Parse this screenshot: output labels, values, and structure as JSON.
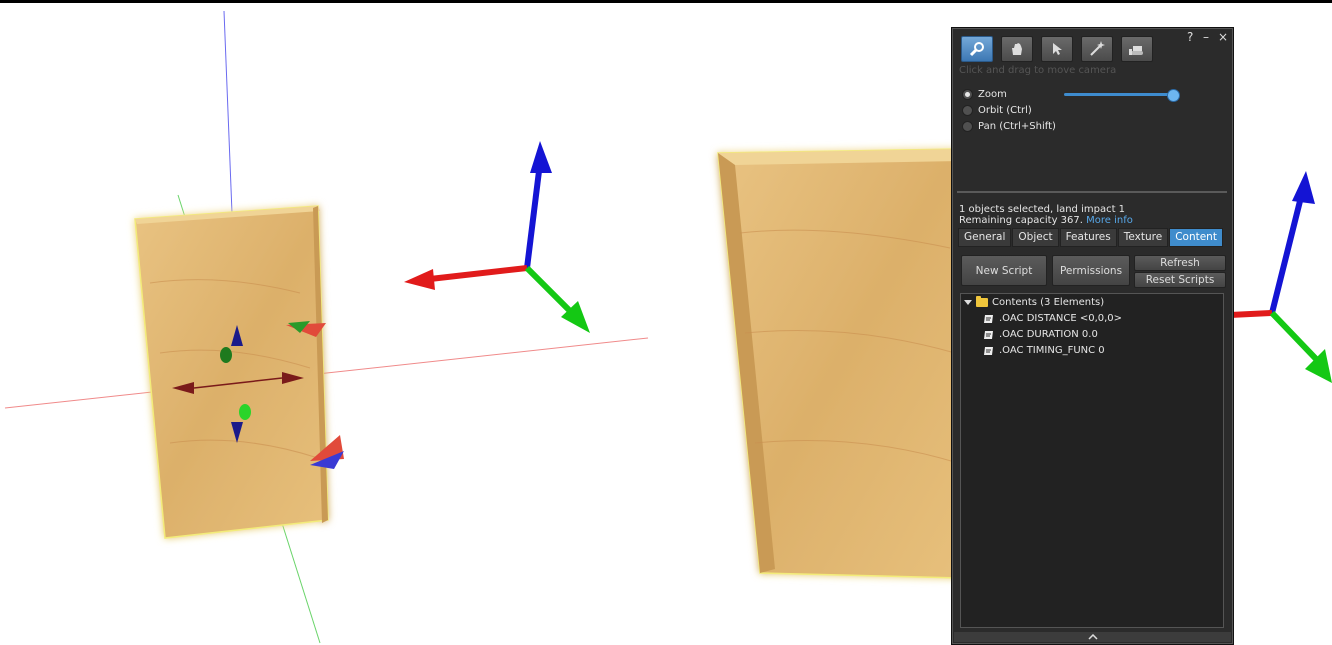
{
  "toolbar": {
    "tools": [
      {
        "name": "focus-tool",
        "icon": "magnifier-icon",
        "active": true
      },
      {
        "name": "move-tool",
        "icon": "hand-icon",
        "active": false
      },
      {
        "name": "edit-tool",
        "icon": "cursor-arrow-icon",
        "active": false
      },
      {
        "name": "create-tool",
        "icon": "wand-icon",
        "active": false
      },
      {
        "name": "land-tool",
        "icon": "bulldozer-icon",
        "active": false
      }
    ],
    "help_label": "?",
    "minimize_label": "–",
    "close_label": "×"
  },
  "hint": "Click and drag to move camera",
  "camera_modes": {
    "zoom": "Zoom",
    "orbit": "Orbit (Ctrl)",
    "pan": "Pan (Ctrl+Shift)",
    "selected": "zoom",
    "zoom_level": 0.95
  },
  "selection": {
    "line1": "1 objects selected, land impact 1",
    "line2": "Remaining capacity 367.",
    "more_info": "More info"
  },
  "tabs": [
    "General",
    "Object",
    "Features",
    "Texture",
    "Content"
  ],
  "active_tab": "Content",
  "buttons": {
    "new_script": "New Script",
    "permissions": "Permissions",
    "refresh": "Refresh",
    "reset_scripts": "Reset Scripts"
  },
  "contents": {
    "folder": "Contents (3 Elements)",
    "items": [
      ".OAC DISTANCE <0,0,0>",
      ".OAC DURATION 0.0",
      ".OAC TIMING_FUNC 0"
    ]
  },
  "colors": {
    "axis_x": "#e11b1b",
    "axis_y": "#14c814",
    "axis_z": "#1414d4",
    "accent": "#3f8ccc",
    "wood": "#e3b873"
  }
}
